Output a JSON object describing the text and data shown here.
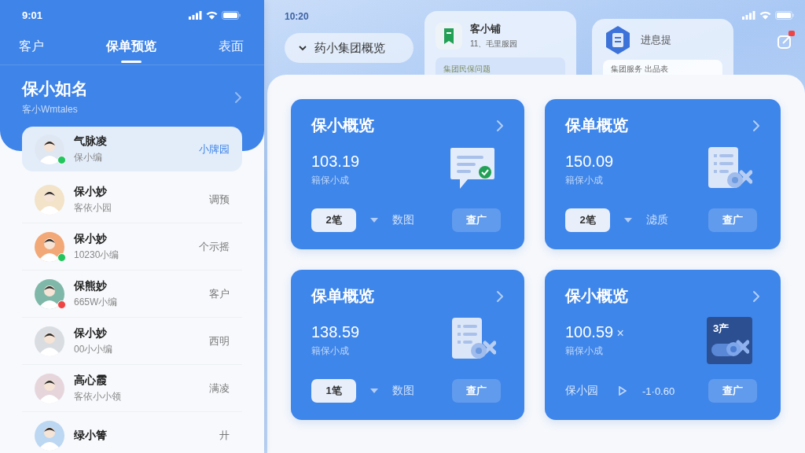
{
  "left_panel": {
    "status_bar": {
      "time": "9:01"
    },
    "tabs": [
      {
        "label": "客户",
        "selected": false
      },
      {
        "label": "保单预览",
        "selected": true
      },
      {
        "label": "表面",
        "selected": false
      }
    ],
    "header": {
      "title": "保小如名",
      "subtitle": "客小Wmtales"
    },
    "contacts": [
      {
        "name": "气脉凌",
        "detail": "保小编",
        "tag": "小牌园",
        "color": "#22c55e",
        "selected": true
      },
      {
        "name": "保小妙",
        "detail": "客依小园",
        "tag": "调预",
        "selected": false
      },
      {
        "name": "保小妙",
        "detail": "10230小编",
        "tag": "个示摇",
        "color": "#22c55e",
        "selected": false
      },
      {
        "name": "保熊妙",
        "detail": "665W小编",
        "tag": "客户",
        "color": "#ef4444",
        "selected": false
      },
      {
        "name": "保小妙",
        "detail": "00小小编",
        "tag": "西明",
        "selected": false
      },
      {
        "name": "高心霞",
        "detail": "客依小小领",
        "tag": "满凌",
        "selected": false
      },
      {
        "name": "绿小箐",
        "tag": "廾",
        "selected": false
      }
    ]
  },
  "main": {
    "status_bar": {
      "time": "10:20"
    },
    "group_selector": {
      "label": "药小集团概览"
    },
    "widgets": [
      {
        "title": "客小铺",
        "subtitle": "11、毛里服园",
        "preview": "集团民保问题",
        "kind": "ledger"
      },
      {
        "title": "进息提",
        "preview": "集团服务 出品表",
        "kind": "document"
      }
    ],
    "notifications": {
      "unread": true
    },
    "cards": [
      {
        "title": "保小概览",
        "value": "103.19",
        "caption": "籍保小成",
        "kind": "chat",
        "footer": {
          "kind": "chip",
          "chip": "2笔",
          "label": "数图",
          "button": "查广"
        }
      },
      {
        "title": "保单概览",
        "value": "150.09",
        "caption": "籍保小成",
        "kind": "sheet",
        "footer": {
          "kind": "chip",
          "chip": "2笔",
          "label": "滤质",
          "button": "查广"
        }
      },
      {
        "title": "保单概览",
        "value": "138.59",
        "caption": "籍保小成",
        "kind": "sheet",
        "footer": {
          "kind": "chip",
          "chip": "1笔",
          "label": "数图",
          "button": "查广"
        }
      },
      {
        "title": "保小概览",
        "value": "100.59",
        "value_mark": "×",
        "caption": "籍保小成",
        "kind": "badge",
        "illustration_text": "3产",
        "footer": {
          "kind": "stat",
          "label": "保小园",
          "reading": "-1·0.60",
          "button": "查广"
        }
      }
    ]
  }
}
